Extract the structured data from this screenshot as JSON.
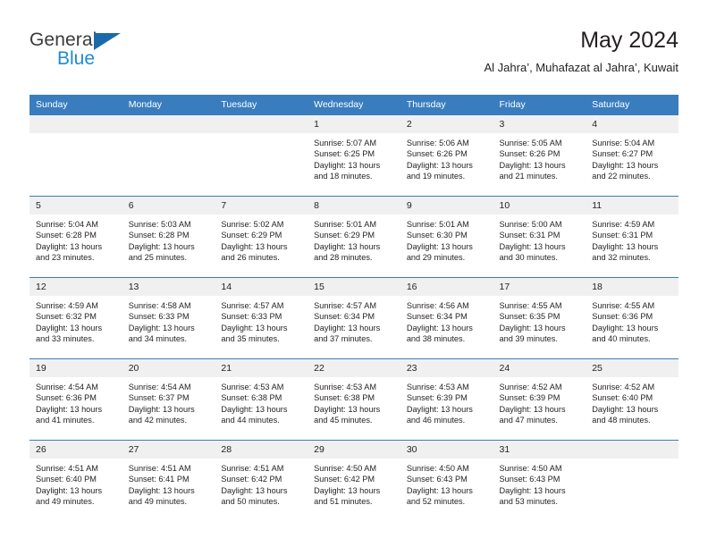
{
  "brand": {
    "name_part1": "General",
    "name_part2": "Blue",
    "triangle_color": "#1a6aab",
    "blue_color": "#1e8ad6"
  },
  "header": {
    "title": "May 2024",
    "subtitle": "Al Jahra’, Muhafazat al Jahra’, Kuwait",
    "header_bg": "#3a7dbe",
    "daynum_bg": "#f0f0f0"
  },
  "weekday_headers": [
    "Sunday",
    "Monday",
    "Tuesday",
    "Wednesday",
    "Thursday",
    "Friday",
    "Saturday"
  ],
  "weeks": [
    [
      {
        "day": "",
        "lines": []
      },
      {
        "day": "",
        "lines": []
      },
      {
        "day": "",
        "lines": []
      },
      {
        "day": "1",
        "lines": [
          "Sunrise: 5:07 AM",
          "Sunset: 6:25 PM",
          "Daylight: 13 hours",
          "and 18 minutes."
        ]
      },
      {
        "day": "2",
        "lines": [
          "Sunrise: 5:06 AM",
          "Sunset: 6:26 PM",
          "Daylight: 13 hours",
          "and 19 minutes."
        ]
      },
      {
        "day": "3",
        "lines": [
          "Sunrise: 5:05 AM",
          "Sunset: 6:26 PM",
          "Daylight: 13 hours",
          "and 21 minutes."
        ]
      },
      {
        "day": "4",
        "lines": [
          "Sunrise: 5:04 AM",
          "Sunset: 6:27 PM",
          "Daylight: 13 hours",
          "and 22 minutes."
        ]
      }
    ],
    [
      {
        "day": "5",
        "lines": [
          "Sunrise: 5:04 AM",
          "Sunset: 6:28 PM",
          "Daylight: 13 hours",
          "and 23 minutes."
        ]
      },
      {
        "day": "6",
        "lines": [
          "Sunrise: 5:03 AM",
          "Sunset: 6:28 PM",
          "Daylight: 13 hours",
          "and 25 minutes."
        ]
      },
      {
        "day": "7",
        "lines": [
          "Sunrise: 5:02 AM",
          "Sunset: 6:29 PM",
          "Daylight: 13 hours",
          "and 26 minutes."
        ]
      },
      {
        "day": "8",
        "lines": [
          "Sunrise: 5:01 AM",
          "Sunset: 6:29 PM",
          "Daylight: 13 hours",
          "and 28 minutes."
        ]
      },
      {
        "day": "9",
        "lines": [
          "Sunrise: 5:01 AM",
          "Sunset: 6:30 PM",
          "Daylight: 13 hours",
          "and 29 minutes."
        ]
      },
      {
        "day": "10",
        "lines": [
          "Sunrise: 5:00 AM",
          "Sunset: 6:31 PM",
          "Daylight: 13 hours",
          "and 30 minutes."
        ]
      },
      {
        "day": "11",
        "lines": [
          "Sunrise: 4:59 AM",
          "Sunset: 6:31 PM",
          "Daylight: 13 hours",
          "and 32 minutes."
        ]
      }
    ],
    [
      {
        "day": "12",
        "lines": [
          "Sunrise: 4:59 AM",
          "Sunset: 6:32 PM",
          "Daylight: 13 hours",
          "and 33 minutes."
        ]
      },
      {
        "day": "13",
        "lines": [
          "Sunrise: 4:58 AM",
          "Sunset: 6:33 PM",
          "Daylight: 13 hours",
          "and 34 minutes."
        ]
      },
      {
        "day": "14",
        "lines": [
          "Sunrise: 4:57 AM",
          "Sunset: 6:33 PM",
          "Daylight: 13 hours",
          "and 35 minutes."
        ]
      },
      {
        "day": "15",
        "lines": [
          "Sunrise: 4:57 AM",
          "Sunset: 6:34 PM",
          "Daylight: 13 hours",
          "and 37 minutes."
        ]
      },
      {
        "day": "16",
        "lines": [
          "Sunrise: 4:56 AM",
          "Sunset: 6:34 PM",
          "Daylight: 13 hours",
          "and 38 minutes."
        ]
      },
      {
        "day": "17",
        "lines": [
          "Sunrise: 4:55 AM",
          "Sunset: 6:35 PM",
          "Daylight: 13 hours",
          "and 39 minutes."
        ]
      },
      {
        "day": "18",
        "lines": [
          "Sunrise: 4:55 AM",
          "Sunset: 6:36 PM",
          "Daylight: 13 hours",
          "and 40 minutes."
        ]
      }
    ],
    [
      {
        "day": "19",
        "lines": [
          "Sunrise: 4:54 AM",
          "Sunset: 6:36 PM",
          "Daylight: 13 hours",
          "and 41 minutes."
        ]
      },
      {
        "day": "20",
        "lines": [
          "Sunrise: 4:54 AM",
          "Sunset: 6:37 PM",
          "Daylight: 13 hours",
          "and 42 minutes."
        ]
      },
      {
        "day": "21",
        "lines": [
          "Sunrise: 4:53 AM",
          "Sunset: 6:38 PM",
          "Daylight: 13 hours",
          "and 44 minutes."
        ]
      },
      {
        "day": "22",
        "lines": [
          "Sunrise: 4:53 AM",
          "Sunset: 6:38 PM",
          "Daylight: 13 hours",
          "and 45 minutes."
        ]
      },
      {
        "day": "23",
        "lines": [
          "Sunrise: 4:53 AM",
          "Sunset: 6:39 PM",
          "Daylight: 13 hours",
          "and 46 minutes."
        ]
      },
      {
        "day": "24",
        "lines": [
          "Sunrise: 4:52 AM",
          "Sunset: 6:39 PM",
          "Daylight: 13 hours",
          "and 47 minutes."
        ]
      },
      {
        "day": "25",
        "lines": [
          "Sunrise: 4:52 AM",
          "Sunset: 6:40 PM",
          "Daylight: 13 hours",
          "and 48 minutes."
        ]
      }
    ],
    [
      {
        "day": "26",
        "lines": [
          "Sunrise: 4:51 AM",
          "Sunset: 6:40 PM",
          "Daylight: 13 hours",
          "and 49 minutes."
        ]
      },
      {
        "day": "27",
        "lines": [
          "Sunrise: 4:51 AM",
          "Sunset: 6:41 PM",
          "Daylight: 13 hours",
          "and 49 minutes."
        ]
      },
      {
        "day": "28",
        "lines": [
          "Sunrise: 4:51 AM",
          "Sunset: 6:42 PM",
          "Daylight: 13 hours",
          "and 50 minutes."
        ]
      },
      {
        "day": "29",
        "lines": [
          "Sunrise: 4:50 AM",
          "Sunset: 6:42 PM",
          "Daylight: 13 hours",
          "and 51 minutes."
        ]
      },
      {
        "day": "30",
        "lines": [
          "Sunrise: 4:50 AM",
          "Sunset: 6:43 PM",
          "Daylight: 13 hours",
          "and 52 minutes."
        ]
      },
      {
        "day": "31",
        "lines": [
          "Sunrise: 4:50 AM",
          "Sunset: 6:43 PM",
          "Daylight: 13 hours",
          "and 53 minutes."
        ]
      },
      {
        "day": "",
        "lines": []
      }
    ]
  ]
}
